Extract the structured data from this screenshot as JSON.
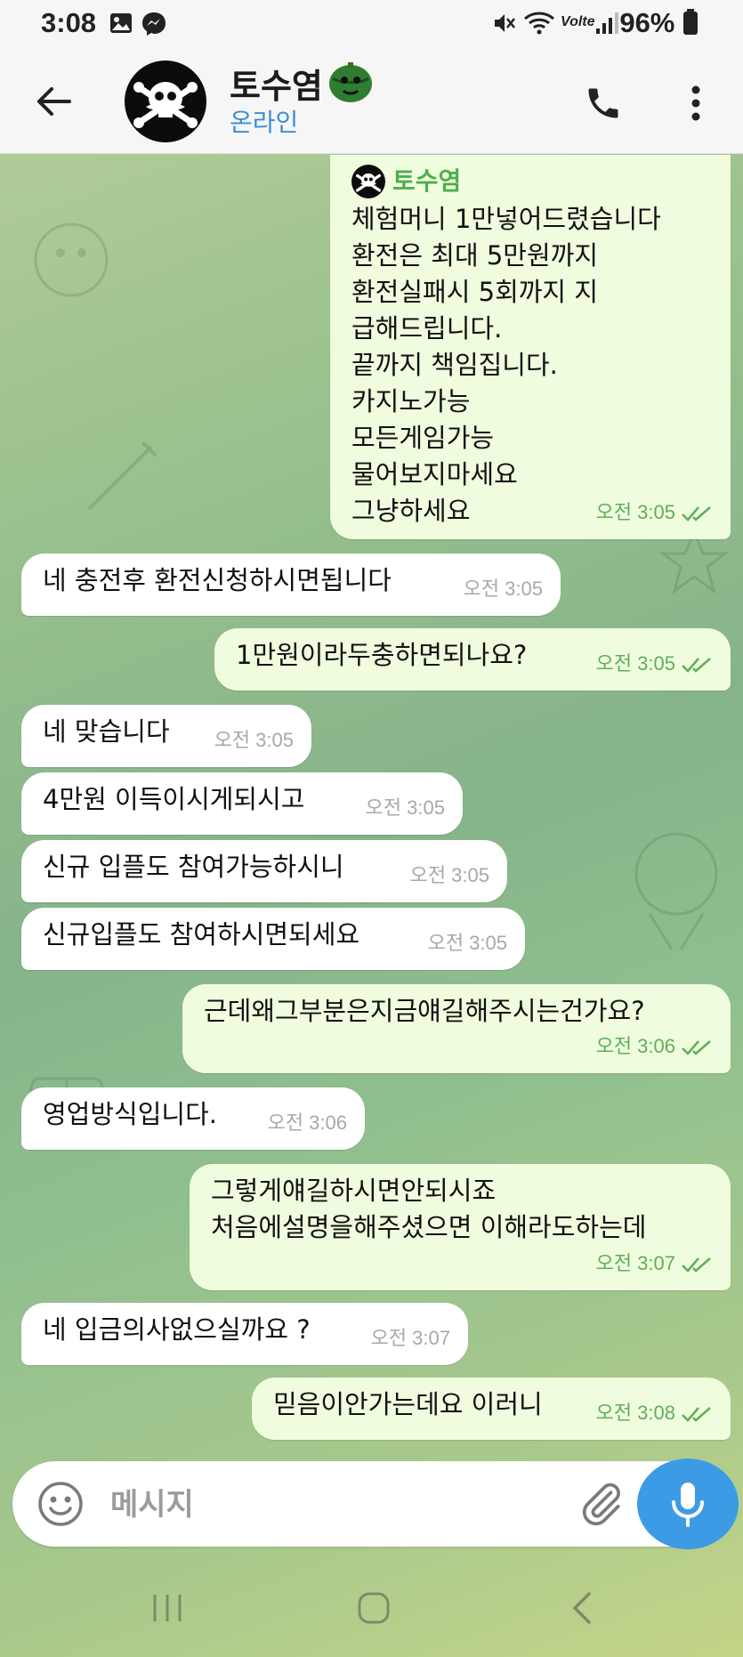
{
  "status_bar": {
    "time": "3:08",
    "network_label": "Volte",
    "battery": "96%"
  },
  "header": {
    "name": "토수염",
    "status": "온라인"
  },
  "messages": [
    {
      "direction": "out",
      "forwarded_from": "토수염",
      "text": "체험머니 1만넣어드렸습니다\n환전은 최대 5만원까지\n환전실패시 5회까지 지\n급해드립니다.\n끝까지 책임집니다.\n카지노가능\n모든게임가능\n물어보지마세요\n그냥하세요",
      "time": "오전 3:05"
    },
    {
      "direction": "in",
      "text": "네 충전후 환전신청하시면됩니다",
      "time": "오전 3:05"
    },
    {
      "direction": "out",
      "text": "1만원이라두충하면되나요?",
      "time": "오전 3:05"
    },
    {
      "direction": "in",
      "text": "네 맞습니다",
      "time": "오전 3:05"
    },
    {
      "direction": "in",
      "text": "4만원 이득이시게되시고",
      "time": "오전 3:05"
    },
    {
      "direction": "in",
      "text": "신규 입플도 참여가능하시니",
      "time": "오전 3:05"
    },
    {
      "direction": "in",
      "text": "신규입플도 참여하시면되세요",
      "time": "오전 3:05"
    },
    {
      "direction": "out",
      "text": "근데왜그부분은지금얘길해주시는건가요?",
      "time": "오전 3:06"
    },
    {
      "direction": "in",
      "text": "영업방식입니다.",
      "time": "오전 3:06"
    },
    {
      "direction": "out",
      "text": "그렇게얘길하시면안되시죠\n처음에설명을해주셨으면 이해라도하는데",
      "time": "오전 3:07"
    },
    {
      "direction": "in",
      "text": "네 입금의사없으실까요 ?",
      "time": "오전 3:07"
    },
    {
      "direction": "out",
      "text": "믿음이안가는데요 이러니",
      "time": "오전 3:08"
    }
  ],
  "composer": {
    "placeholder": "메시지"
  },
  "colors": {
    "incoming_bubble": "#ffffff",
    "outgoing_bubble": "#effdde",
    "accent": "#3d9be6",
    "outgoing_meta": "#5fae5a"
  }
}
